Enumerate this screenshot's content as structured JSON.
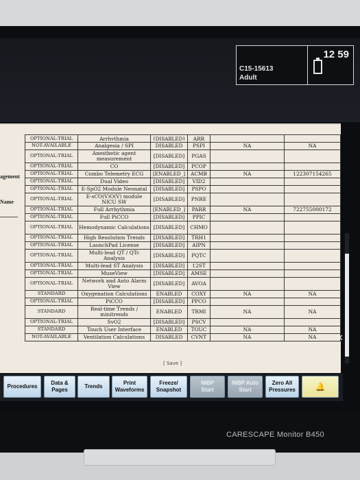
{
  "header": {
    "patient_id": "C15-15613",
    "patient_type": "Adult",
    "clock": "12 59"
  },
  "side_labels": [
    "agement",
    "Name"
  ],
  "table": {
    "rows": [
      {
        "status": "OPTIONAL-TRIAL",
        "name": "Arrhythmia",
        "state": "[DISABLED]",
        "code": "ARR",
        "v1": "",
        "v2": "",
        "cut": true
      },
      {
        "status": "NOT-AVAILABLE",
        "name": "Analgesia / SPI",
        "state": "DISABLED",
        "code": "PSPI",
        "v1": "NA",
        "v2": "NA"
      },
      {
        "status": "OPTIONAL-TRIAL",
        "name": "Anesthetic agent measurement",
        "state": "[DISABLED]",
        "code": "PGAS",
        "v1": "",
        "v2": "",
        "tall": true
      },
      {
        "status": "OPTIONAL-TRIAL",
        "name": "CO",
        "state": "[DISABLED]",
        "code": "PCOP",
        "v1": "",
        "v2": ""
      },
      {
        "status": "OPTIONAL-TRIAL",
        "name": "Combo Telemetry ECG",
        "state": "[ENABLED_]",
        "code": "ACMB",
        "v1": "NA",
        "v2": "122307154265"
      },
      {
        "status": "OPTIONAL-TRIAL",
        "name": "Dual Video",
        "state": "[DISABLED]",
        "code": "VID2",
        "v1": "",
        "v2": ""
      },
      {
        "status": "OPTIONAL-TRIAL",
        "name": "E-SpO2 Module Neonatal",
        "state": "[DISABLED]",
        "code": "PSPO",
        "v1": "",
        "v2": ""
      },
      {
        "status": "OPTIONAL-TRIAL",
        "name": "E-sCO(V)O(V) module NICU SW",
        "state": "[DISABLED]",
        "code": "PNRE",
        "v1": "",
        "v2": "",
        "tall": true
      },
      {
        "status": "OPTIONAL-TRIAL",
        "name": "Full Arrhythmia",
        "state": "[ENABLED_]",
        "code": "PARR",
        "v1": "NA",
        "v2": "722755000172"
      },
      {
        "status": "OPTIONAL-TRIAL",
        "name": "Full PiCCO",
        "state": "[DISABLED]",
        "code": "PPIC",
        "v1": "",
        "v2": ""
      },
      {
        "status": "OPTIONAL-TRIAL",
        "name": "Hemodynamic Calculations",
        "state": "[DISABLED]",
        "code": "CHMO",
        "v1": "",
        "v2": "",
        "tall": true
      },
      {
        "status": "OPTIONAL-TRIAL",
        "name": "High Resolution Trends",
        "state": "[DISABLED]",
        "code": "TRH1",
        "v1": "",
        "v2": ""
      },
      {
        "status": "OPTIONAL-TRIAL",
        "name": "LaunchPad License",
        "state": "[DISABLED]",
        "code": "AIPN",
        "v1": "",
        "v2": ""
      },
      {
        "status": "OPTIONAL-TRIAL",
        "name": "Multi-lead QT / QTc Analysis",
        "state": "[DISABLED]",
        "code": "PQTC",
        "v1": "",
        "v2": "",
        "tall": true
      },
      {
        "status": "OPTIONAL-TRIAL",
        "name": "Multi-lead ST Analysis",
        "state": "[DISABLED]",
        "code": "12ST",
        "v1": "",
        "v2": ""
      },
      {
        "status": "OPTIONAL-TRIAL",
        "name": "MuseView",
        "state": "[DISABLED]",
        "code": "AMSE",
        "v1": "",
        "v2": ""
      },
      {
        "status": "OPTIONAL-TRIAL",
        "name": "Network and Auto Alarm View",
        "state": "[DISABLED]",
        "code": "AVOA",
        "v1": "",
        "v2": "",
        "tall": true
      },
      {
        "status": "STANDARD",
        "name": "Oxygenation Calculations",
        "state": "ENABLED",
        "code": "COXY",
        "v1": "NA",
        "v2": "NA"
      },
      {
        "status": "OPTIONAL-TRIAL",
        "name": "PiCCO",
        "state": "[DISABLED]",
        "code": "PPCO",
        "v1": "",
        "v2": ""
      },
      {
        "status": "STANDARD",
        "name": "Real-time Trends / minitrends",
        "state": "ENABLED",
        "code": "TRMI",
        "v1": "NA",
        "v2": "NA",
        "tall": true
      },
      {
        "status": "OPTIONAL-TRIAL",
        "name": "SvO2",
        "state": "[DISABLED]",
        "code": "PSCV",
        "v1": "",
        "v2": ""
      },
      {
        "status": "STANDARD",
        "name": "Touch User Interface",
        "state": "ENABLED",
        "code": "TOUC",
        "v1": "NA",
        "v2": "NA"
      },
      {
        "status": "NOT-AVAILABLE",
        "name": "Ventilation Calculations",
        "state": "DISABLED",
        "code": "CVNT",
        "v1": "NA",
        "v2": "NA"
      }
    ]
  },
  "save_label": "[ Save ]",
  "menu": {
    "buttons": [
      {
        "label": "Procedures",
        "state": "enabled"
      },
      {
        "label": "Data &\nPages",
        "state": "enabled"
      },
      {
        "label": "Trends",
        "state": "enabled"
      },
      {
        "label": "Print\nWaveforms",
        "state": "enabled"
      },
      {
        "label": "Freeze/\nSnapshot",
        "state": "enabled"
      },
      {
        "label": "NIBP\nStart",
        "state": "disabled"
      },
      {
        "label": "NIBP Auto\nStart",
        "state": "disabled"
      },
      {
        "label": "Zero All\nPressures",
        "state": "enabled"
      },
      {
        "icon": "alarm-bell-icon",
        "state": "enabled"
      }
    ]
  },
  "brand": "CARESCAPE Monitor B450"
}
